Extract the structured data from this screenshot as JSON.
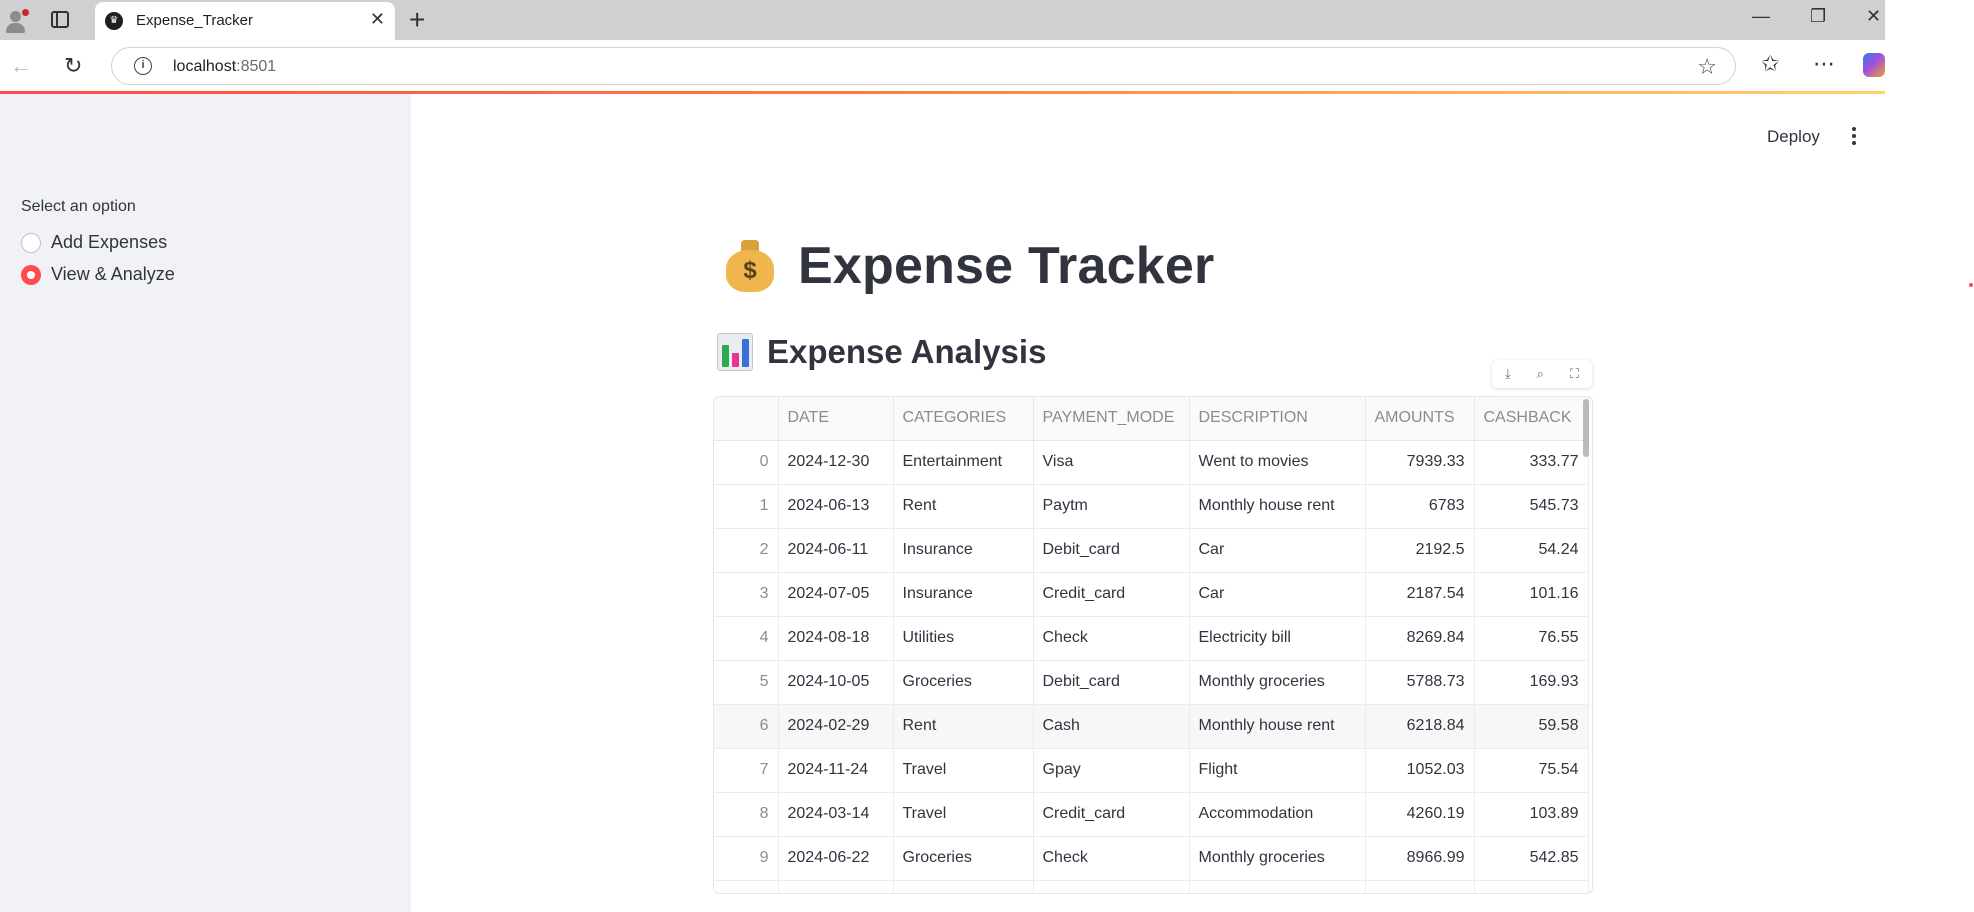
{
  "browser": {
    "tab_title": "Expense_Tracker",
    "url_host": "localhost",
    "url_port": ":8501",
    "favicon": "streamlit-crown-icon"
  },
  "sidebar": {
    "label": "Select an option",
    "options": [
      {
        "label": "Add Expenses",
        "selected": false
      },
      {
        "label": "View & Analyze",
        "selected": true
      }
    ]
  },
  "header": {
    "deploy_label": "Deploy"
  },
  "main": {
    "title_emoji": "money-bag-icon",
    "title": "Expense Tracker",
    "subtitle_emoji": "bar-chart-icon",
    "subtitle": "Expense Analysis",
    "bag_symbol": "$"
  },
  "table": {
    "columns": [
      "",
      "DATE",
      "CATEGORIES",
      "PAYMENT_MODE",
      "DESCRIPTION",
      "AMOUNTS",
      "CASHBACK"
    ],
    "rows": [
      [
        "0",
        "2024-12-30",
        "Entertainment",
        "Visa",
        "Went to movies",
        "7939.33",
        "333.77"
      ],
      [
        "1",
        "2024-06-13",
        "Rent",
        "Paytm",
        "Monthly house rent",
        "6783",
        "545.73"
      ],
      [
        "2",
        "2024-06-11",
        "Insurance",
        "Debit_card",
        "Car",
        "2192.5",
        "54.24"
      ],
      [
        "3",
        "2024-07-05",
        "Insurance",
        "Credit_card",
        "Car",
        "2187.54",
        "101.16"
      ],
      [
        "4",
        "2024-08-18",
        "Utilities",
        "Check",
        "Electricity bill",
        "8269.84",
        "76.55"
      ],
      [
        "5",
        "2024-10-05",
        "Groceries",
        "Debit_card",
        "Monthly groceries",
        "5788.73",
        "169.93"
      ],
      [
        "6",
        "2024-02-29",
        "Rent",
        "Cash",
        "Monthly house rent",
        "6218.84",
        "59.58"
      ],
      [
        "7",
        "2024-11-24",
        "Travel",
        "Gpay",
        "Flight",
        "1052.03",
        "75.54"
      ],
      [
        "8",
        "2024-03-14",
        "Travel",
        "Credit_card",
        "Accommodation",
        "4260.19",
        "103.89"
      ],
      [
        "9",
        "2024-06-22",
        "Groceries",
        "Check",
        "Monthly groceries",
        "8966.99",
        "542.85"
      ]
    ],
    "highlighted_row": 6
  },
  "colors": {
    "accent": "#ff4b4b",
    "sidebar_bg": "#f0f2f6",
    "text": "#31333f"
  }
}
